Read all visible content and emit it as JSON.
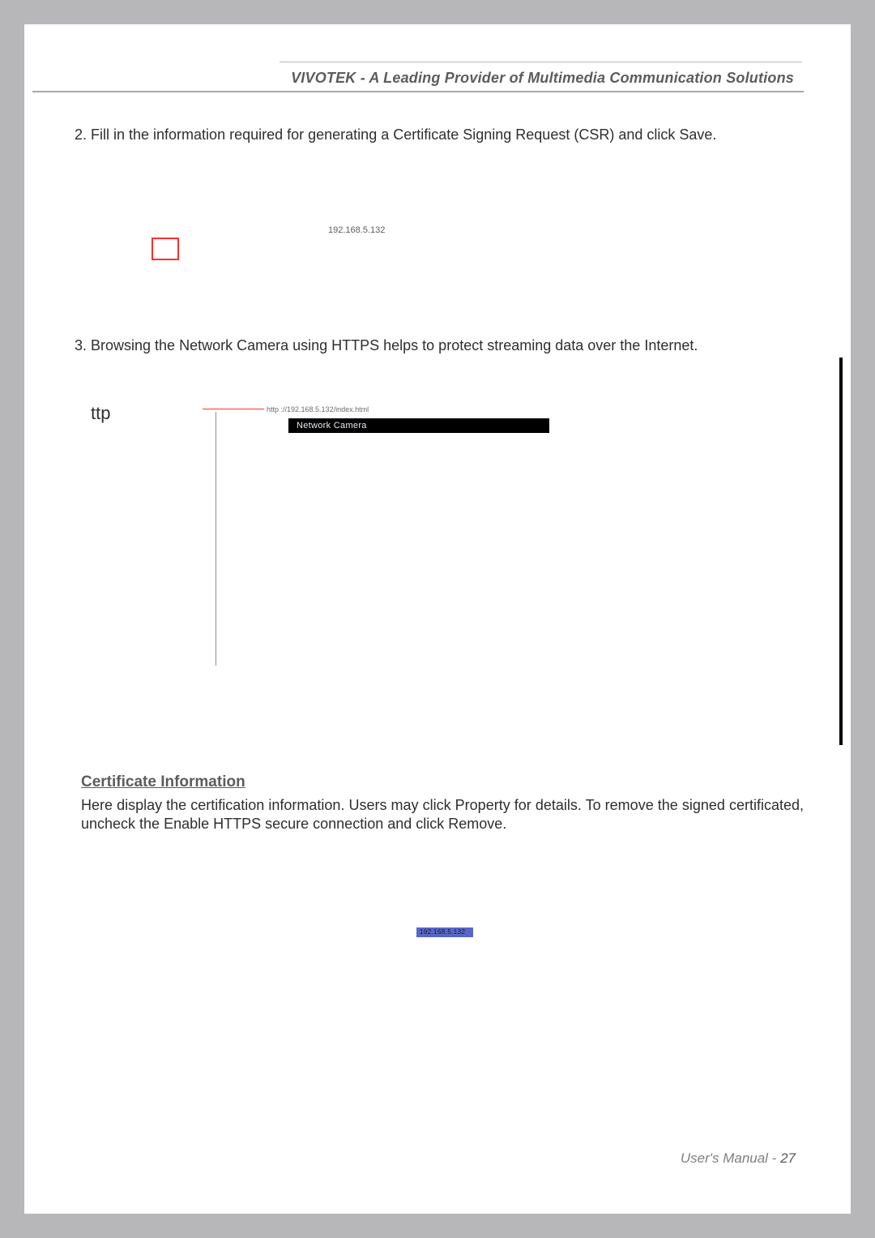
{
  "header": {
    "title": "VIVOTEK - A Leading Provider of Multimedia Communication Solutions"
  },
  "steps": {
    "s2": "2. Fill in the information required for generating a Certificate Signing Request (CSR) and click Save.",
    "s3": "3. Browsing the Network Camera using HTTPS helps to protect streaming data over the Internet."
  },
  "ip": "192.168.5.132",
  "protocol_fragment": "ttp",
  "browser_url": "http ://192.168.5.132/index.html",
  "camera_titlebar": "Network Camera",
  "blue_badge_text": "192.168.5.132",
  "cert_section": {
    "heading": "Certificate Information",
    "body": "Here display the certification information. Users may click Property for details. To remove the signed certificated, uncheck the Enable HTTPS secure connection and click Remove."
  },
  "footer": {
    "label": "User's Manual - ",
    "page": "27"
  }
}
